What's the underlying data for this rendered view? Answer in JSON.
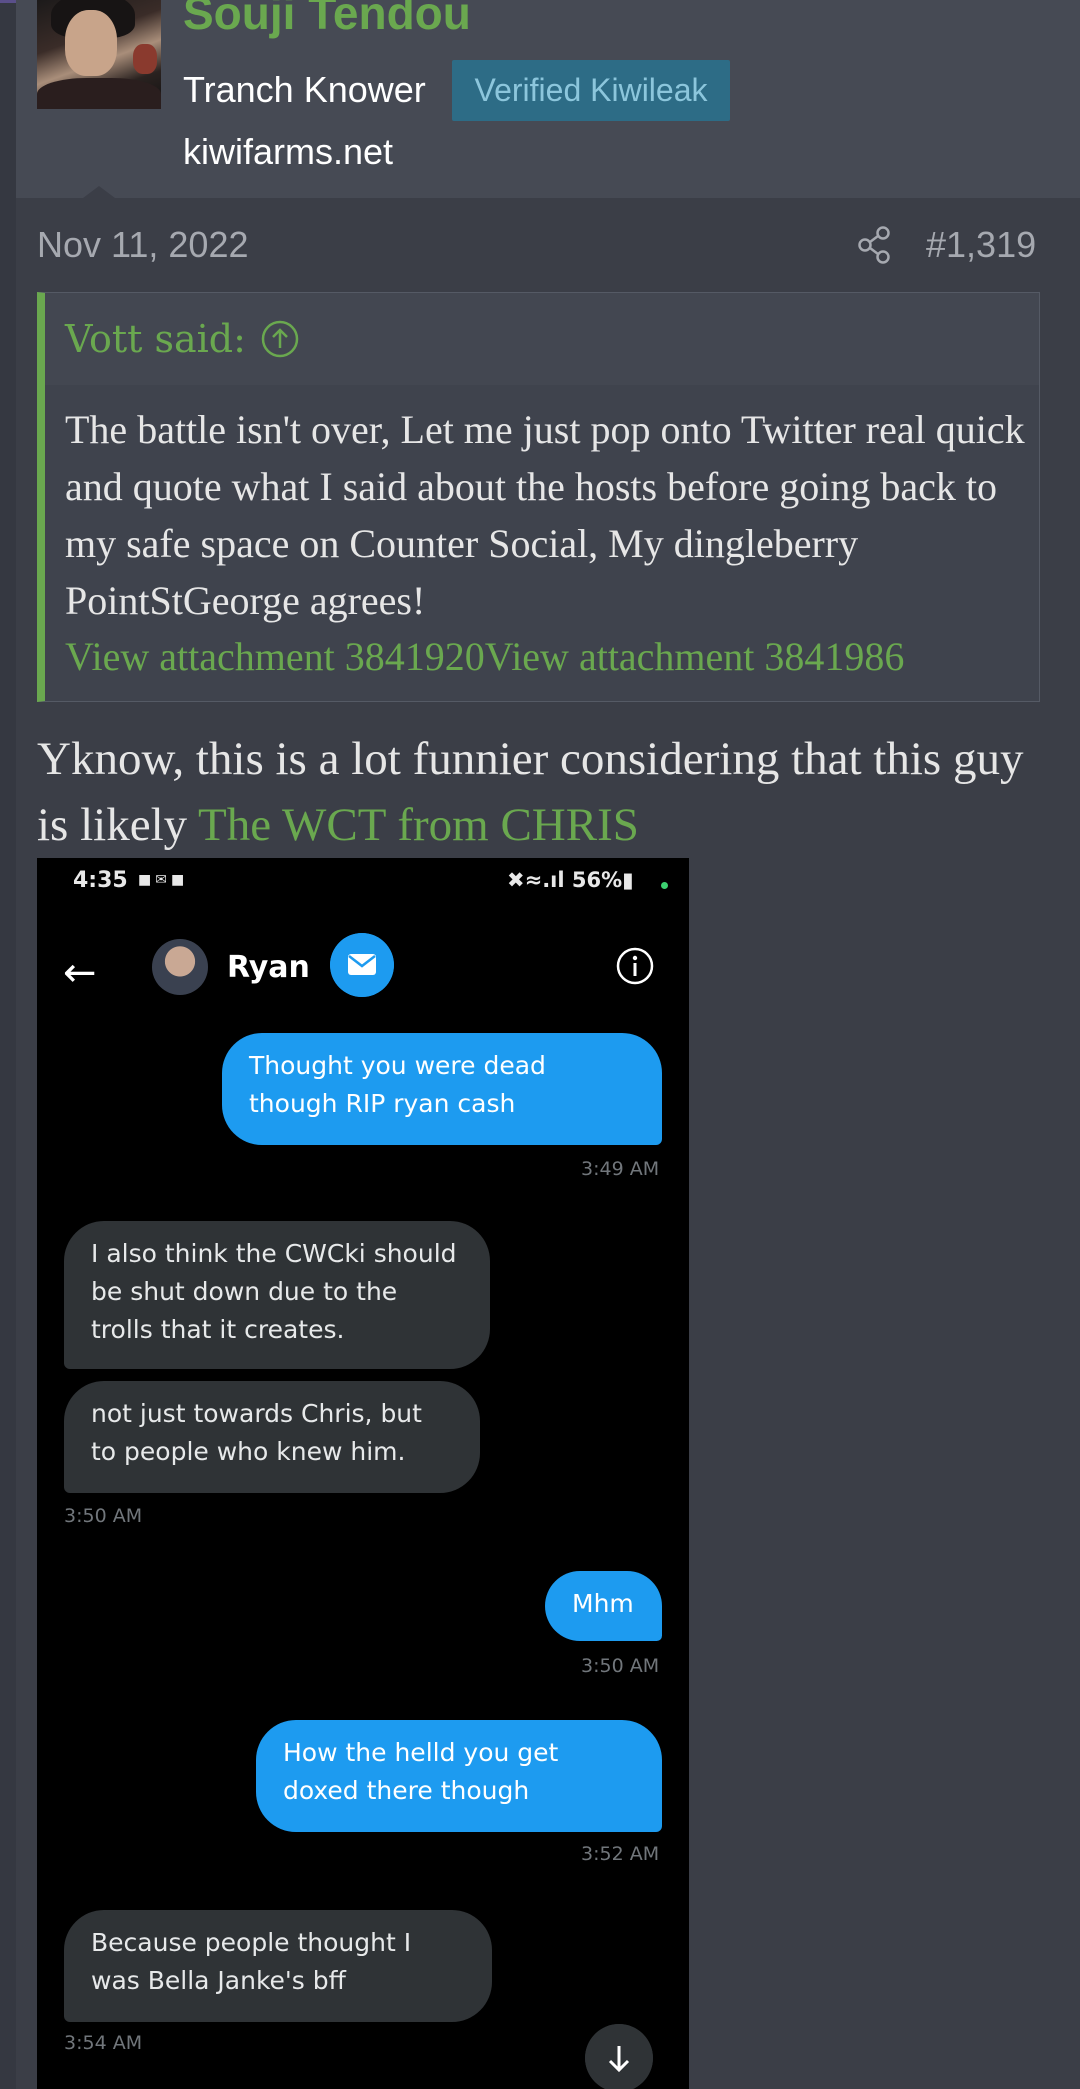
{
  "user": {
    "name": "Souji Tendou",
    "title": "Tranch Knower",
    "badge": "Verified Kiwileak",
    "site": "kiwifarms.net"
  },
  "post": {
    "date": "Nov 11, 2022",
    "number": "#1,319",
    "share_icon": "share-icon"
  },
  "quote": {
    "author": "Vott said:",
    "body": "The battle isn't over, Let me just pop onto Twitter real quick and quote what I said about the hosts before going back to my safe space on Counter Social, My dingleberry PointStGeorge agrees!",
    "attachments": "View attachment 3841920View attachment 3841986"
  },
  "body": {
    "text": "Yknow, this is a lot funnier considering that this guy is likely ",
    "link": "The WCT from CHRIS"
  },
  "screenshot": {
    "status_time": "4:35",
    "status_battery": "56%",
    "chat_name": "Ryan",
    "messages": [
      {
        "text": "Thought you were dead though RIP ryan cash",
        "time": "3:49 AM"
      },
      {
        "text": "I also think the CWCki should be shut down due to the trolls that it creates."
      },
      {
        "text": "not just towards Chris, but to people who knew him.",
        "time": "3:50 AM"
      },
      {
        "text": "Mhm",
        "time": "3:50 AM"
      },
      {
        "text": "How the helld you get doxed there though",
        "time": "3:52 AM"
      },
      {
        "text": "Because people thought I was Bella Janke's bff",
        "time": "3:54 AM"
      }
    ]
  },
  "colors": {
    "accent_green": "#6aa84f",
    "badge_bg": "#2d6c86",
    "bubble_out": "#1d9bf0",
    "bubble_in": "#2f3336"
  }
}
